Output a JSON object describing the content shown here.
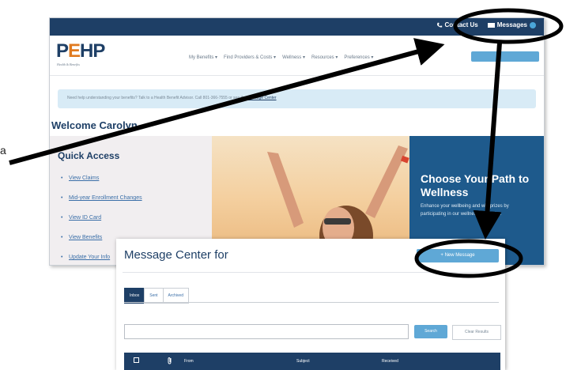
{
  "portal": {
    "topbar": {
      "contact_label": "Contact Us",
      "messages_label": "Messages"
    },
    "logo": "PEHP",
    "logo_tagline": "Health & Benefits",
    "nav": [
      "My Benefits ▾",
      "Find Providers & Costs ▾",
      "Wellness ▾",
      "Resources ▾",
      "Preferences ▾"
    ],
    "alert": {
      "text": "Need help understanding your benefits? Talk to a Health Benefit Advisor. Call 801-366-7555 or see the",
      "link": "Message Center"
    },
    "welcome": "Welcome Carolyn",
    "quick_access": {
      "title": "Quick Access",
      "items": [
        "View Claims",
        "Mid-year Enrollment Changes",
        "View ID Card",
        "View Benefits",
        "Update Your Info"
      ]
    },
    "wellness": {
      "title": "Choose Your Path to Wellness",
      "text": "Enhance your wellbeing and win prizes by participating in our wellness programs."
    }
  },
  "message_center": {
    "title": "Message Center for",
    "new_message": "+ New Message",
    "tabs": [
      "Inbox",
      "Sent",
      "Archived"
    ],
    "search_button": "Search",
    "clear_button": "Clear Results",
    "columns": [
      "From",
      "Subject",
      "Received"
    ]
  },
  "annotation": {
    "side_letter": "a"
  },
  "colors": {
    "navy": "#1e3f66",
    "light_blue": "#5fa8d6",
    "orange": "#e07a1f"
  }
}
